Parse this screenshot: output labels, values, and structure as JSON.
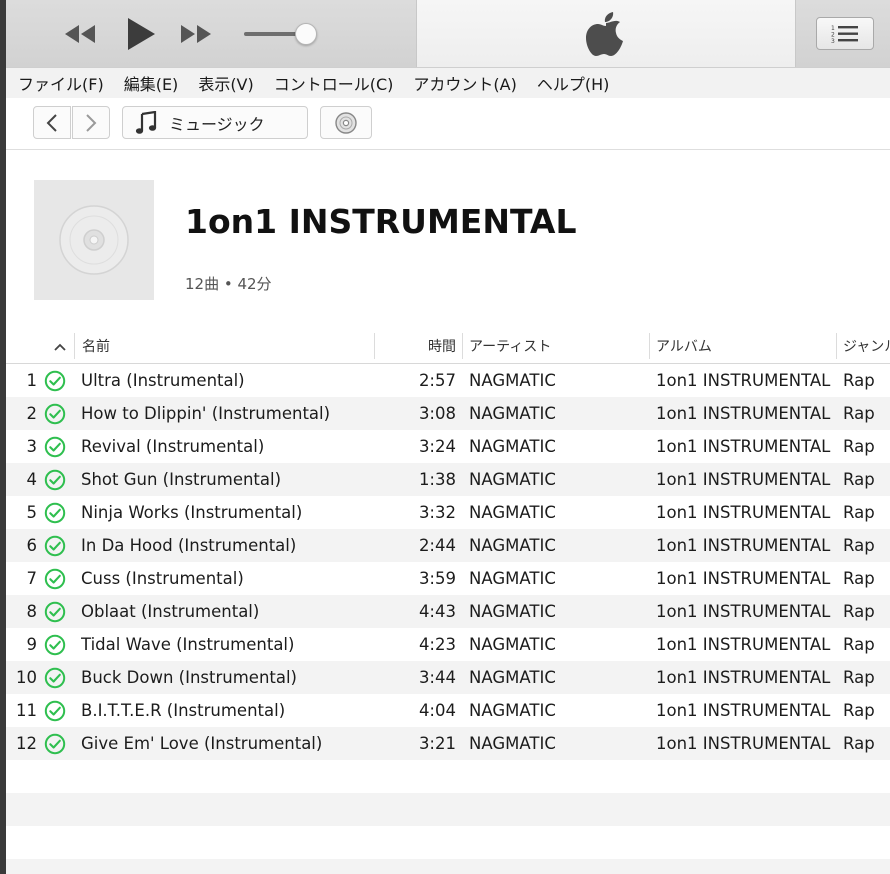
{
  "menubar": {
    "items": [
      "ファイル(F)",
      "編集(E)",
      "表示(V)",
      "コントロール(C)",
      "アカウント(A)",
      "ヘルプ(H)"
    ]
  },
  "navbar": {
    "media_label": "ミュージック"
  },
  "album": {
    "title": "1on1 INSTRUMENTAL",
    "meta": "12曲 • 42分"
  },
  "table": {
    "headers": {
      "name": "名前",
      "time": "時間",
      "artist": "アーティスト",
      "album": "アルバム",
      "genre": "ジャンル"
    },
    "rows": [
      {
        "num": "1",
        "name": "Ultra (Instrumental)",
        "time": "2:57",
        "artist": "NAGMATIC",
        "album": "1on1 INSTRUMENTAL",
        "genre": "Rap"
      },
      {
        "num": "2",
        "name": "How to Dlippin' (Instrumental)",
        "time": "3:08",
        "artist": "NAGMATIC",
        "album": "1on1 INSTRUMENTAL",
        "genre": "Rap"
      },
      {
        "num": "3",
        "name": "Revival (Instrumental)",
        "time": "3:24",
        "artist": "NAGMATIC",
        "album": "1on1 INSTRUMENTAL",
        "genre": "Rap"
      },
      {
        "num": "4",
        "name": "Shot Gun (Instrumental)",
        "time": "1:38",
        "artist": "NAGMATIC",
        "album": "1on1 INSTRUMENTAL",
        "genre": "Rap"
      },
      {
        "num": "5",
        "name": "Ninja Works (Instrumental)",
        "time": "3:32",
        "artist": "NAGMATIC",
        "album": "1on1 INSTRUMENTAL",
        "genre": "Rap"
      },
      {
        "num": "6",
        "name": "In Da Hood (Instrumental)",
        "time": "2:44",
        "artist": "NAGMATIC",
        "album": "1on1 INSTRUMENTAL",
        "genre": "Rap"
      },
      {
        "num": "7",
        "name": "Cuss (Instrumental)",
        "time": "3:59",
        "artist": "NAGMATIC",
        "album": "1on1 INSTRUMENTAL",
        "genre": "Rap"
      },
      {
        "num": "8",
        "name": "Oblaat (Instrumental)",
        "time": "4:43",
        "artist": "NAGMATIC",
        "album": "1on1 INSTRUMENTAL",
        "genre": "Rap"
      },
      {
        "num": "9",
        "name": "Tidal Wave (Instrumental)",
        "time": "4:23",
        "artist": "NAGMATIC",
        "album": "1on1 INSTRUMENTAL",
        "genre": "Rap"
      },
      {
        "num": "10",
        "name": "Buck Down (Instrumental)",
        "time": "3:44",
        "artist": "NAGMATIC",
        "album": "1on1 INSTRUMENTAL",
        "genre": "Rap"
      },
      {
        "num": "11",
        "name": "B.I.T.T.E.R (Instrumental)",
        "time": "4:04",
        "artist": "NAGMATIC",
        "album": "1on1 INSTRUMENTAL",
        "genre": "Rap"
      },
      {
        "num": "12",
        "name": "Give Em' Love (Instrumental)",
        "time": "3:21",
        "artist": "NAGMATIC",
        "album": "1on1 INSTRUMENTAL",
        "genre": "Rap"
      }
    ]
  },
  "colors": {
    "check_green": "#2fbf4f",
    "row_alt": "#f3f3f3"
  }
}
